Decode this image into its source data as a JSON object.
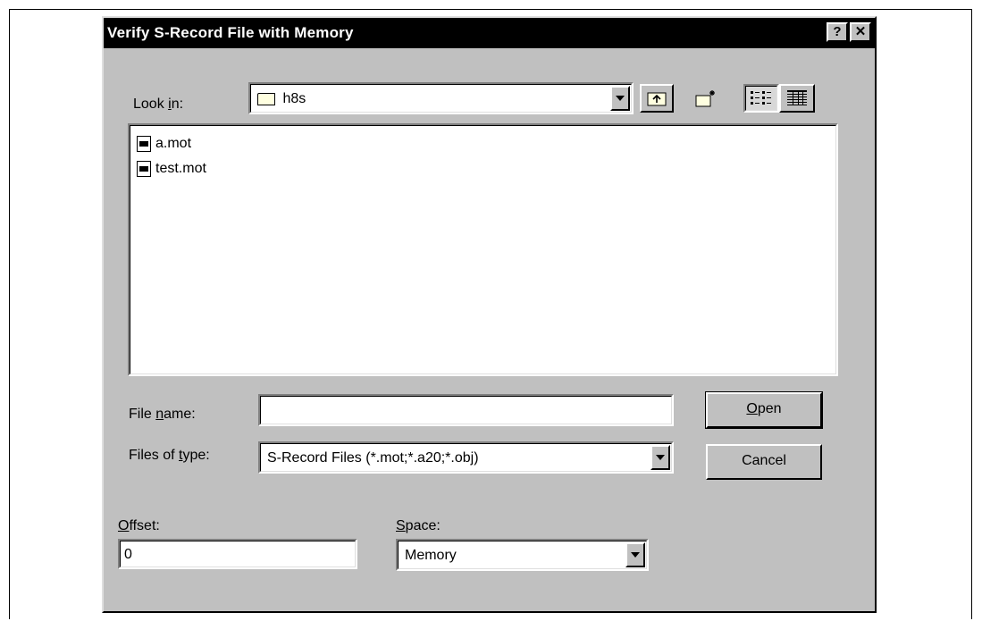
{
  "dialog": {
    "title": "Verify S-Record File with Memory",
    "help_glyph": "?",
    "close_glyph": "✕"
  },
  "look_in": {
    "label_pre": "Look ",
    "label_accel": "i",
    "label_post": "n:",
    "value": "h8s"
  },
  "toolbar": {
    "up_icon": "up-folder-icon",
    "new_folder_icon": "new-folder-icon",
    "list_icon": "list-view-icon",
    "details_icon": "details-view-icon"
  },
  "files": [
    {
      "name": "a.mot"
    },
    {
      "name": "test.mot"
    }
  ],
  "file_name": {
    "label_pre": "File ",
    "label_accel": "n",
    "label_post": "ame:",
    "value": ""
  },
  "files_of_type": {
    "label_pre": "Files of ",
    "label_accel": "t",
    "label_post": "ype:",
    "value": "S-Record Files (*.mot;*.a20;*.obj)"
  },
  "buttons": {
    "open_accel": "O",
    "open_rest": "pen",
    "cancel": "Cancel"
  },
  "offset": {
    "label_accel": "O",
    "label_rest": "ffset:",
    "value": "0"
  },
  "space": {
    "label_accel": "S",
    "label_rest": "pace:",
    "value": "Memory"
  }
}
